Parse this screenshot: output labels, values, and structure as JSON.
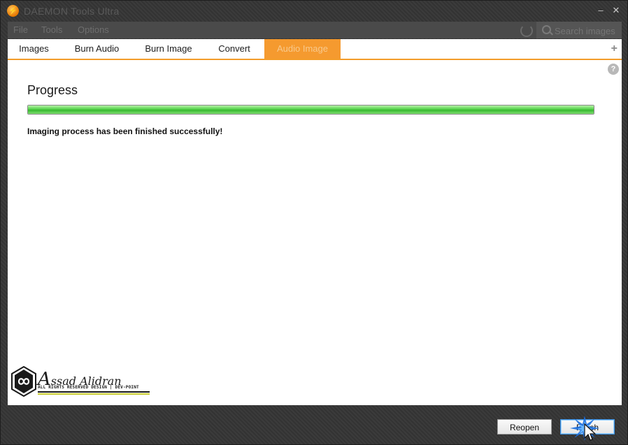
{
  "window": {
    "title": "DAEMON Tools Ultra",
    "minimize_glyph": "–",
    "close_glyph": "✕"
  },
  "menu": {
    "items": [
      "File",
      "Tools",
      "Options"
    ],
    "refresh_icon": "refresh-icon",
    "search_placeholder": "Search images"
  },
  "tabs": {
    "items": [
      "Images",
      "Burn Audio",
      "Burn Image",
      "Convert",
      "Audio Image"
    ],
    "active": "Audio Image",
    "add_glyph": "+"
  },
  "content": {
    "help_glyph": "?",
    "progress_title": "Progress",
    "progress_fraction": 1.0,
    "status_text": "Imaging process has been finished successfully!"
  },
  "watermark": {
    "name_initial": "A",
    "name_rest": "ssad Alidran",
    "tagline": "ALL RIGHTS RESERVED DESIGN | DEV-POINT"
  },
  "footer": {
    "reopen_label": "Reopen",
    "finish_label": "Finish"
  },
  "colors": {
    "accent": "#f59a2f",
    "progress_green": "#36b72f",
    "watermark_yellow": "#c9cc2c"
  }
}
